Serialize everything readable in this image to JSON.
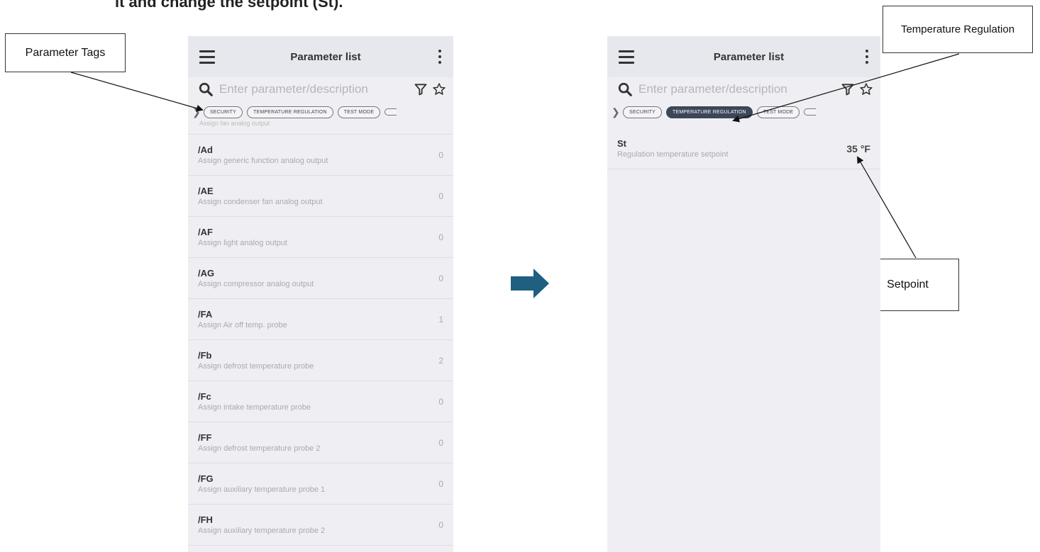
{
  "header_text": "it and change the setpoint (St).",
  "callouts": {
    "parameter_tags": "Parameter Tags",
    "temperature_regulation": "Temperature Regulation",
    "setpoint": "Setpoint"
  },
  "phone_left": {
    "title": "Parameter list",
    "search_placeholder": "Enter parameter/description",
    "tags": [
      "SECURITY",
      "TEMPERATURE REGULATION",
      "TEST MODE"
    ],
    "ghost_text": "Assign fan analog output",
    "rows": [
      {
        "code": "/Ad",
        "desc": "Assign generic function analog output",
        "value": "0"
      },
      {
        "code": "/AE",
        "desc": "Assign condenser fan analog output",
        "value": "0"
      },
      {
        "code": "/AF",
        "desc": "Assign light analog output",
        "value": "0"
      },
      {
        "code": "/AG",
        "desc": "Assign compressor analog output",
        "value": "0"
      },
      {
        "code": "/FA",
        "desc": "Assign Air off temp. probe",
        "value": "1"
      },
      {
        "code": "/Fb",
        "desc": "Assign defrost temperature probe",
        "value": "2"
      },
      {
        "code": "/Fc",
        "desc": "Assign intake temperature probe",
        "value": "0"
      },
      {
        "code": "/FF",
        "desc": "Assign defrost temperature probe 2",
        "value": "0"
      },
      {
        "code": "/FG",
        "desc": "Assign auxiliary temperature probe 1",
        "value": "0"
      },
      {
        "code": "/FH",
        "desc": "Assign auxiliary temperature probe 2",
        "value": "0"
      }
    ]
  },
  "phone_right": {
    "title": "Parameter list",
    "search_placeholder": "Enter parameter/description",
    "tags": [
      "SECURITY",
      "TEMPERATURE REGULATION",
      "TEST MODE"
    ],
    "active_tag": "TEMPERATURE REGULATION",
    "rows": [
      {
        "code": "St",
        "desc": "Regulation temperature setpoint",
        "value": "35 °F"
      }
    ]
  },
  "colors": {
    "transition_arrow": "#1f5f7f",
    "active_chip": "#3b4758",
    "phone_bg": "#efeff3"
  }
}
